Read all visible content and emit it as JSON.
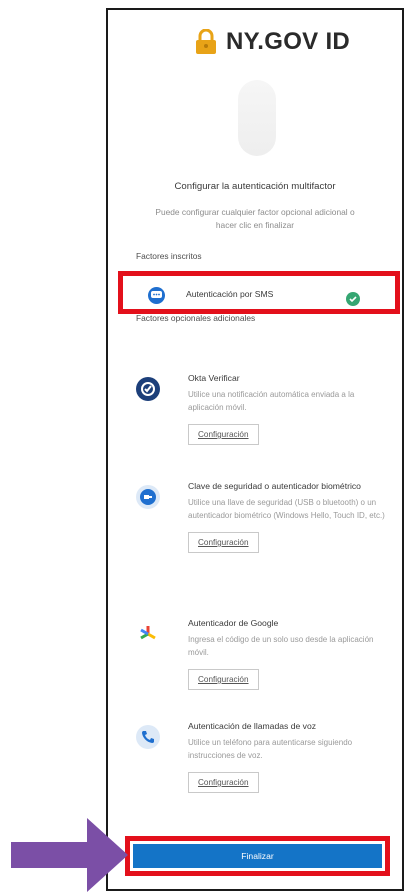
{
  "header": {
    "brand": "NY.GOV ID"
  },
  "page": {
    "title": "Configurar la autenticación multifactor",
    "subtitle": "Puede configurar cualquier factor opcional adicional o hacer clic en finalizar"
  },
  "enrolled": {
    "heading": "Factores inscritos",
    "items": [
      {
        "label": "Autenticación por SMS",
        "status": "enrolled",
        "icon": "sms-chat-icon"
      }
    ]
  },
  "optional": {
    "heading": "Factores opcionales adicionales",
    "items": [
      {
        "name": "Okta Verificar",
        "description": "Utilice una notificación automática enviada a la aplicación móvil.",
        "button": "Configuración",
        "icon": "okta-verify-icon"
      },
      {
        "name": "Clave de seguridad o autenticador biométrico",
        "description": "Utilice una llave de seguridad (USB o bluetooth) o un autenticador biométrico (Windows Hello, Touch ID, etc.)",
        "button": "Configuración",
        "icon": "security-key-icon"
      },
      {
        "name": "Autenticador de Google",
        "description": "Ingresa el código de un solo uso desde la aplicación móvil.",
        "button": "Configuración",
        "icon": "google-authenticator-icon"
      },
      {
        "name": "Autenticación de llamadas de voz",
        "description": "Utilice un teléfono para autenticarse siguiendo instrucciones de voz.",
        "button": "Configuración",
        "icon": "phone-call-icon"
      }
    ]
  },
  "footer": {
    "finish_label": "Finalizar"
  },
  "colors": {
    "accent": "#1474c7",
    "highlight": "#e3101b",
    "arrow": "#7b4fa6",
    "success": "#35a672",
    "lock": "#e8a317"
  }
}
